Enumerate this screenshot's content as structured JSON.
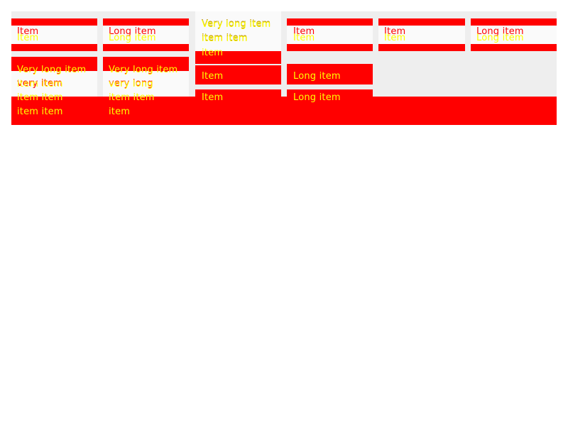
{
  "colors": {
    "panel": "#eeeeee",
    "box": "#fafafa",
    "accent": "#ff0000",
    "text": "#ffff00"
  },
  "labels": {
    "item": "Item",
    "long": "Long item",
    "very_long": "Very long item",
    "item_item": "item item",
    "item_lower": "item",
    "very_long_lower": "very long",
    "very_item": "very item"
  }
}
